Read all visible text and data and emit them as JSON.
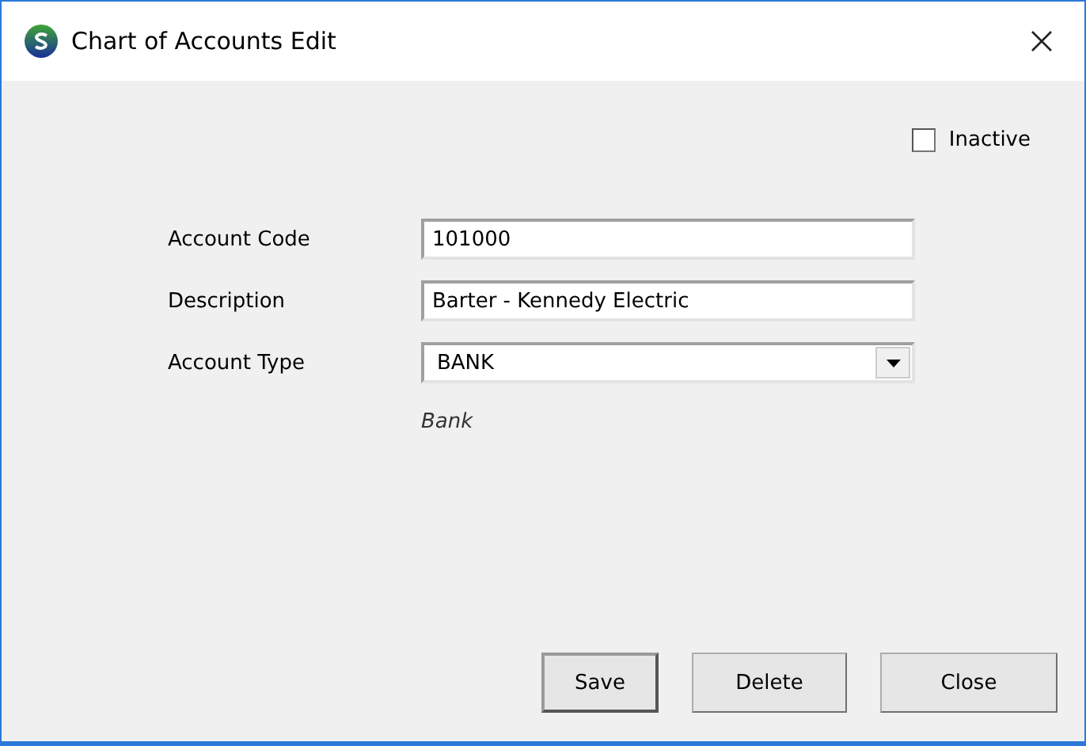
{
  "window": {
    "title": "Chart of Accounts Edit"
  },
  "inactive": {
    "label": "Inactive",
    "checked": false
  },
  "fields": [
    {
      "kind": "text",
      "label": "Account Code",
      "value": "101000"
    },
    {
      "kind": "text",
      "label": "Description",
      "value": "Barter - Kennedy Electric"
    },
    {
      "kind": "dropdown",
      "label": "Account Type",
      "value": "BANK"
    }
  ],
  "type_note": "Bank",
  "buttons": [
    {
      "label": "Save",
      "default": true
    },
    {
      "label": "Delete",
      "default": false
    },
    {
      "label": "Close",
      "default": false
    }
  ]
}
